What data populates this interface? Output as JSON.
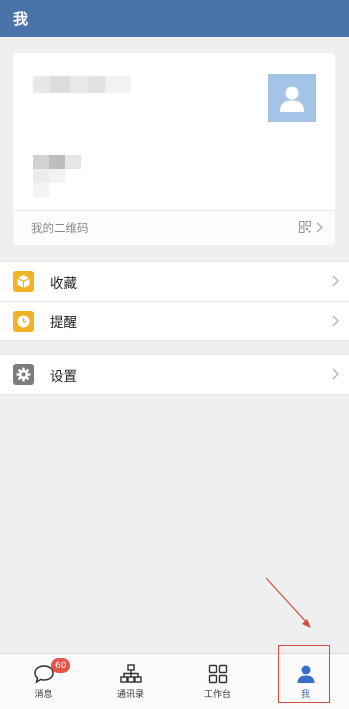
{
  "header": {
    "title": "我"
  },
  "profile": {
    "qr_label": "我的二维码"
  },
  "menu_group_1": [
    {
      "label": "收藏",
      "icon": "favorites-icon",
      "color": "#f0b327"
    },
    {
      "label": "提醒",
      "icon": "reminder-clock-icon",
      "color": "#f0b327"
    }
  ],
  "menu_group_2": [
    {
      "label": "设置",
      "icon": "gear-icon",
      "color": "#7c7c7c"
    }
  ],
  "tabs": [
    {
      "label": "消息",
      "icon": "message-bubble-icon",
      "badge": "60"
    },
    {
      "label": "通讯录",
      "icon": "contacts-tree-icon"
    },
    {
      "label": "工作台",
      "icon": "workbench-grid-icon"
    },
    {
      "label": "我",
      "icon": "person-icon",
      "active": true
    }
  ],
  "colors": {
    "header": "#4a73aa",
    "active_tab": "#3b6ec6",
    "badge": "#e9534a",
    "annotation": "#d84a3a"
  }
}
